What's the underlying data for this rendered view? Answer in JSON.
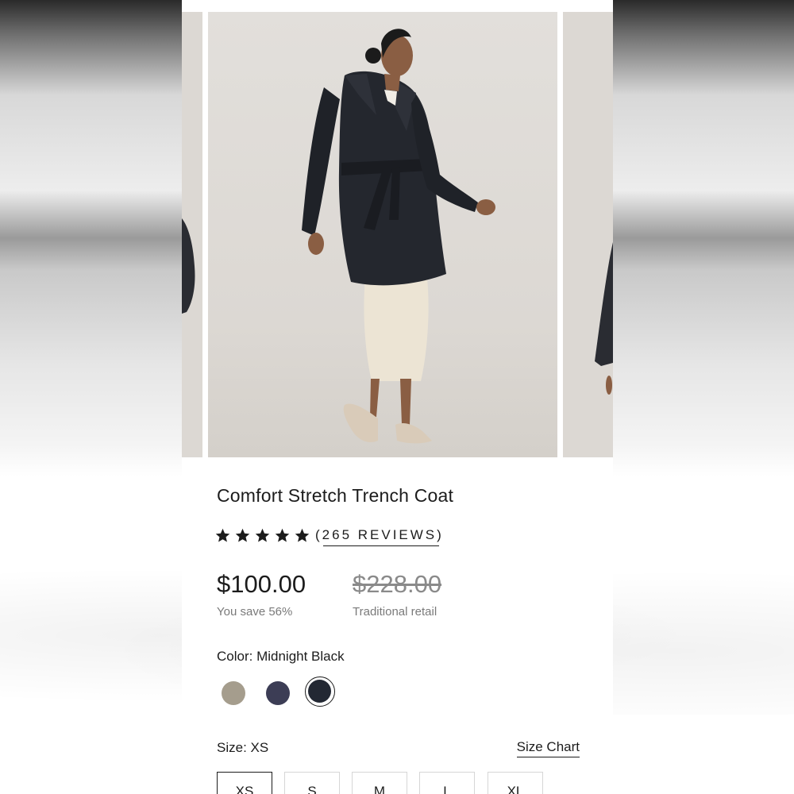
{
  "product": {
    "title": "Comfort Stretch Trench Coat",
    "rating": 5,
    "rating_max": 5,
    "reviews_label": "(265 REVIEWS)",
    "price": "$100.00",
    "savings": "You save 56%",
    "original_price": "$228.00",
    "original_label": "Traditional retail"
  },
  "color": {
    "label": "Color: Midnight Black",
    "swatches": [
      {
        "name": "taupe",
        "hex": "#a59d8d",
        "selected": false
      },
      {
        "name": "navy",
        "hex": "#3c3d55",
        "selected": false
      },
      {
        "name": "midnight-black",
        "hex": "#232833",
        "selected": true
      }
    ]
  },
  "size": {
    "label": "Size: XS",
    "chart_link": "Size Chart",
    "options": [
      "XS",
      "S",
      "M",
      "L",
      "XL"
    ],
    "selected": "XS"
  },
  "gallery": {
    "coat_color": "#24272e",
    "skirt_color": "#ece4d4",
    "backdrop_color": "#dcd8d3"
  }
}
